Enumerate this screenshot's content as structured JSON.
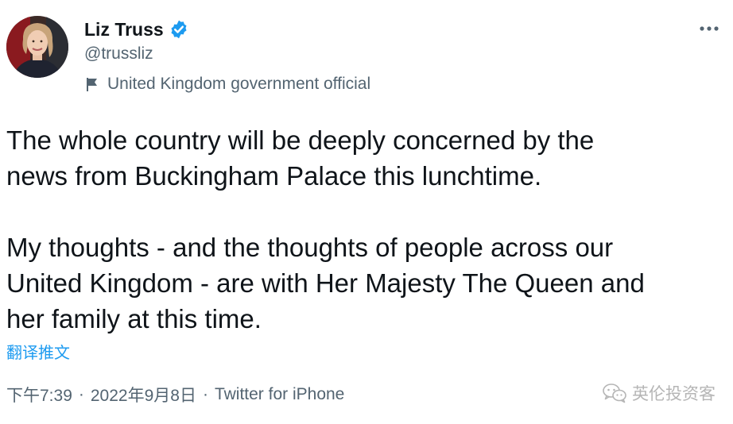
{
  "author": {
    "display_name": "Liz Truss",
    "handle": "@trussliz",
    "verified": true,
    "label": "United Kingdom government official"
  },
  "tweet": {
    "paragraph1": [
      "The whole country will be deeply concerned by the",
      "news from Buckingham Palace this lunchtime."
    ],
    "paragraph2": [
      "My thoughts - and the thoughts of people across our",
      "United Kingdom - are with Her Majesty The Queen and",
      "her family at this time."
    ]
  },
  "translate_label": "翻译推文",
  "meta": {
    "time": "下午7:39",
    "separator": "·",
    "date": "2022年9月8日",
    "source": "Twitter for iPhone"
  },
  "watermark": {
    "text": "英伦投资客"
  },
  "colors": {
    "accent": "#1d9bf0",
    "text_primary": "#0f1419",
    "text_secondary": "#536471",
    "watermark": "#b5b5b5"
  },
  "icons": {
    "verified": "verified-badge-icon",
    "government": "flag-icon",
    "more": "more-horizontal-icon",
    "watermark": "wechat-logo-icon"
  }
}
